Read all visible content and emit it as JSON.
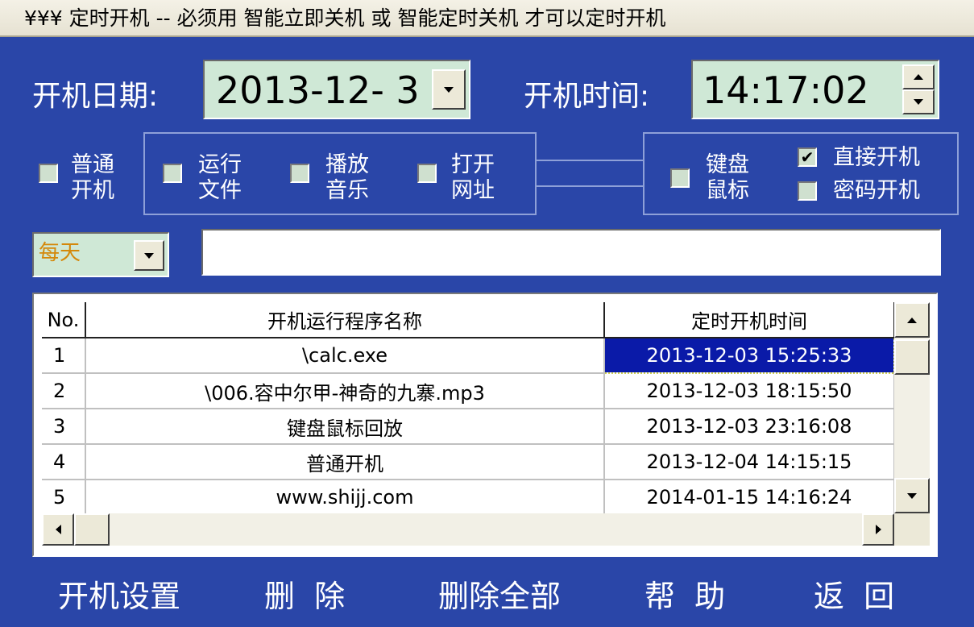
{
  "title": "¥¥¥ 定时开机 -- 必须用 智能立即关机 或 智能定时关机 才可以定时开机",
  "date": {
    "label": "开机日期:",
    "value": "2013-12- 3"
  },
  "time": {
    "label": "开机时间:",
    "value": "14:17:02"
  },
  "options": [
    {
      "label_line1": "普通",
      "label_line2": "开机",
      "checked": false
    },
    {
      "label_line1": "运行",
      "label_line2": "文件",
      "checked": false
    },
    {
      "label_line1": "播放",
      "label_line2": "音乐",
      "checked": false
    },
    {
      "label_line1": "打开",
      "label_line2": "网址",
      "checked": false
    },
    {
      "label_line1": "键盘",
      "label_line2": "鼠标",
      "checked": false
    }
  ],
  "mode": {
    "direct": {
      "label": "直接开机",
      "checked": true,
      "mark": "✔"
    },
    "password": {
      "label": "密码开机",
      "checked": false
    }
  },
  "repeat": {
    "value": "每天",
    "color": "#d4880a"
  },
  "path_input": {
    "value": ""
  },
  "table": {
    "headers": [
      "No.",
      "开机运行程序名称",
      "定时开机时间"
    ],
    "rows": [
      {
        "no": "1",
        "name": "\\calc.exe",
        "time": "2013-12-03  15:25:33",
        "selected": true
      },
      {
        "no": "2",
        "name": "\\006.容中尔甲-神奇的九寨.mp3",
        "time": "2013-12-03  18:15:50",
        "selected": false
      },
      {
        "no": "3",
        "name": "键盘鼠标回放",
        "time": "2013-12-03  23:16:08",
        "selected": false
      },
      {
        "no": "4",
        "name": "普通开机",
        "time": "2013-12-04  14:15:15",
        "selected": false
      },
      {
        "no": "5",
        "name": "www.shijj.com",
        "time": "2014-01-15  14:16:24",
        "selected": false
      }
    ]
  },
  "buttons": {
    "settings": "开机设置",
    "delete": "删  除",
    "delete_all": "删除全部",
    "help": "帮  助",
    "back": "返  回"
  }
}
